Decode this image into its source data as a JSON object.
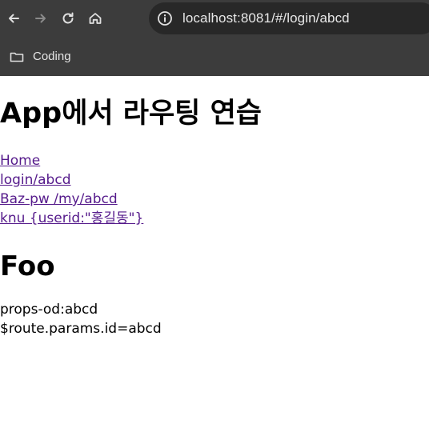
{
  "browser": {
    "url": "localhost:8081/#/login/abcd",
    "bookmarks": [
      {
        "label": "Coding",
        "icon": "folder-icon"
      }
    ]
  },
  "page": {
    "title": "App에서 라우팅 연습",
    "links": [
      "Home",
      "login/abcd",
      "Baz-pw /my/abcd",
      "knu {userid:\"홍길동\"}"
    ],
    "view_title": "Foo",
    "props_line": "props-od:abcd",
    "params_line": "$route.params.id=abcd"
  },
  "colors": {
    "toolbar_bg": "#3c3c3c",
    "omnibox_bg": "#282828",
    "link_visited": "#551a8b"
  }
}
